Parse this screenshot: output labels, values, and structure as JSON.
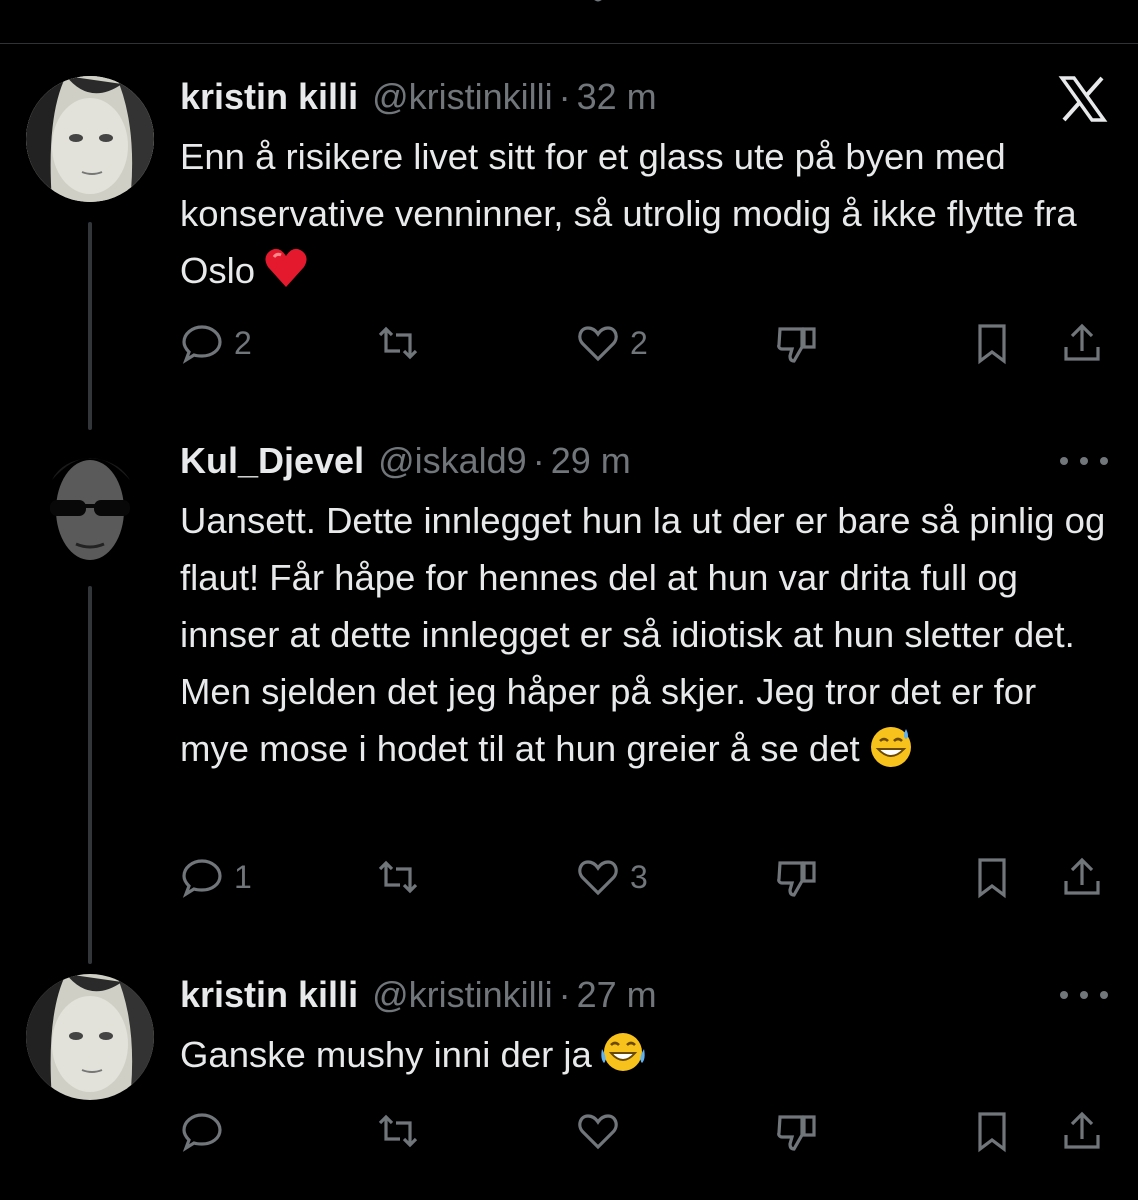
{
  "tweets": [
    {
      "name": "kristin killi",
      "handle": "@kristinkilli",
      "separator": "·",
      "time": "32 m",
      "text": "Enn å risikere livet sitt for et glass ute på byen med konservative venninner, så utrolig modig å ikke flytte fra Oslo",
      "emoji": "red-heart-icon",
      "replies": "2",
      "reposts": "",
      "likes": "2"
    },
    {
      "name": "Kul_Djevel",
      "handle": "@iskald9",
      "separator": "·",
      "time": "29 m",
      "text": "Uansett. Dette innlegget hun la ut der er bare så pinlig og flaut! Får håpe for hennes del at hun var drita full og innser at dette innlegget er så idiotisk at hun sletter det. Men sjelden det jeg håper på skjer. Jeg tror det er for mye mose i hodet til at hun greier å se det",
      "emoji": "grinning-sweat-emoji-icon",
      "replies": "1",
      "reposts": "",
      "likes": "3"
    },
    {
      "name": "kristin killi",
      "handle": "@kristinkilli",
      "separator": "·",
      "time": "27 m",
      "text": "Ganske mushy inni der ja",
      "emoji": "tears-of-joy-emoji-icon",
      "replies": "",
      "reposts": "",
      "likes": ""
    }
  ],
  "colors": {
    "background": "#000000",
    "text": "#e7e9ea",
    "secondary": "#71767b",
    "divider": "#2f3336",
    "thread_line": "#333639"
  }
}
